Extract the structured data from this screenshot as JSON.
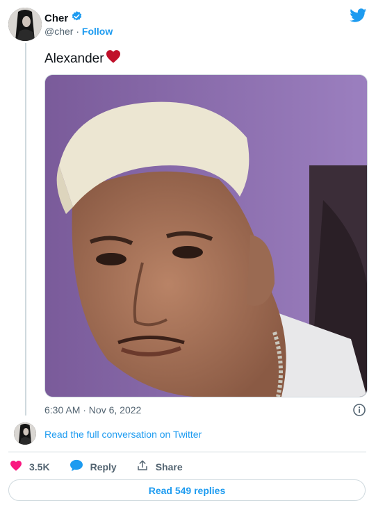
{
  "author": {
    "name": "Cher",
    "handle": "@cher",
    "separator": "·",
    "follow_label": "Follow",
    "verified": true
  },
  "tweet": {
    "text": "Alexander",
    "emoji": "heart",
    "timestamp": "6:30 AM · Nov 6, 2022"
  },
  "conversation": {
    "label": "Read the full conversation on Twitter"
  },
  "actions": {
    "likes": "3.5K",
    "reply_label": "Reply",
    "share_label": "Share"
  },
  "replies_button": {
    "label": "Read 549 replies"
  },
  "icons": {
    "verified": "verified-badge-icon",
    "logo": "twitter-bird-icon",
    "info": "info-icon",
    "like": "heart-icon",
    "reply": "speech-bubble-icon",
    "share": "share-upload-icon"
  },
  "colors": {
    "accent": "#1d9bf0",
    "like": "#f91880",
    "heart_emoji": "#c0102a",
    "text": "#0f1419",
    "muted": "#536471",
    "border": "#cfd9de"
  }
}
